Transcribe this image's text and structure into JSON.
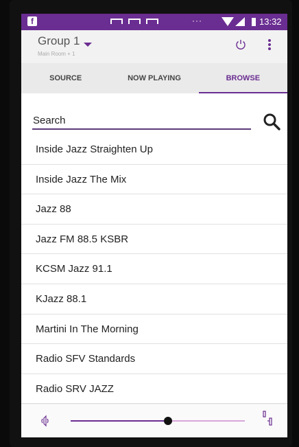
{
  "status_bar": {
    "time": "13:32",
    "overflow": "···",
    "app_icon": "facebook-icon"
  },
  "header": {
    "group_title": "Group 1",
    "group_subtitle": "Main Room + 1",
    "power_icon": "power-icon",
    "menu_icon": "more-vertical-icon"
  },
  "tabs": [
    {
      "label": "SOURCE",
      "active": false
    },
    {
      "label": "NOW PLAYING",
      "active": false
    },
    {
      "label": "BROWSE",
      "active": true
    }
  ],
  "search": {
    "placeholder": "Search",
    "value": ""
  },
  "stations": [
    "Inside Jazz Straighten Up",
    "Inside Jazz The Mix",
    "Jazz 88",
    "Jazz FM 88.5 KSBR",
    "KCSM Jazz 91.1",
    "KJazz 88.1",
    "Martini In The Morning",
    "Radio SFV Standards",
    "Radio SRV JAZZ"
  ],
  "volume": {
    "level": 0.56
  },
  "colors": {
    "accent": "#6a2d91",
    "slider_track": "#d9a6d9"
  }
}
